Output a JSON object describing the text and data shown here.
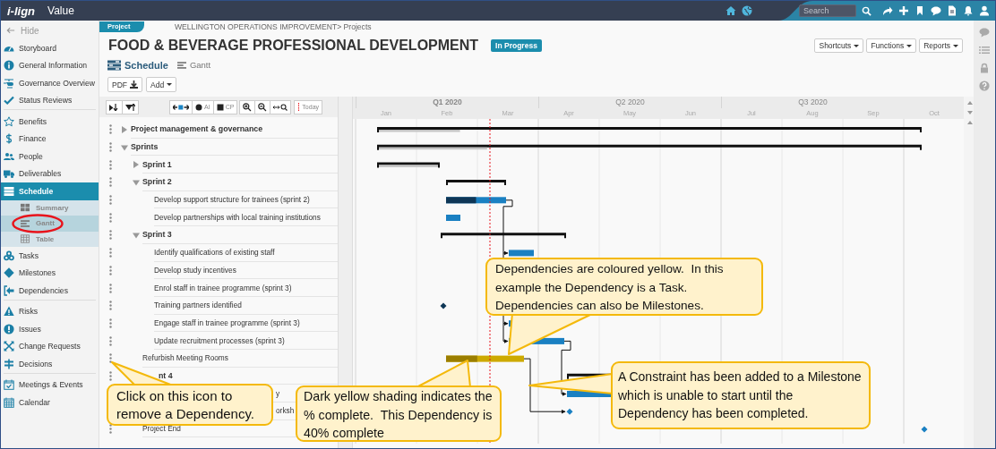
{
  "topbar": {
    "logo": "i-lign",
    "product": "Value",
    "search": {
      "placeholder": "Search"
    }
  },
  "sidebar": {
    "hide": "Hide",
    "groups": [
      {
        "items": [
          {
            "label": "Storyboard",
            "selected": false
          },
          {
            "label": "General Information",
            "selected": false
          },
          {
            "label": "Governance Overview",
            "selected": false
          },
          {
            "label": "Status Reviews",
            "selected": false
          }
        ]
      },
      {
        "items": [
          {
            "label": "Benefits",
            "selected": false
          },
          {
            "label": "Finance",
            "selected": false
          },
          {
            "label": "People",
            "selected": false
          },
          {
            "label": "Deliverables",
            "selected": false
          },
          {
            "label": "Schedule",
            "selected": true,
            "children": [
              {
                "label": "Summary",
                "selected": false,
                "circled": false
              },
              {
                "label": "Gantt",
                "selected": true,
                "circled": true
              },
              {
                "label": "Table",
                "selected": false,
                "circled": false
              }
            ]
          },
          {
            "label": "Tasks",
            "selected": false
          },
          {
            "label": "Milestones",
            "selected": false
          },
          {
            "label": "Dependencies",
            "selected": false
          }
        ]
      },
      {
        "items": [
          {
            "label": "Risks",
            "selected": false
          },
          {
            "label": "Issues",
            "selected": false
          },
          {
            "label": "Change Requests",
            "selected": false
          },
          {
            "label": "Decisions",
            "selected": false
          }
        ]
      },
      {
        "items": [
          {
            "label": "Meetings & Events",
            "selected": false
          },
          {
            "label": "Calendar",
            "selected": false
          }
        ]
      }
    ]
  },
  "header": {
    "tab": "Project",
    "breadcrumb": "WELLINGTON OPERATIONS IMPROVEMENT> Projects",
    "title": "FOOD & BEVERAGE PROFESSIONAL DEVELOPMENT",
    "status": "In Progress",
    "menus": [
      "Shortcuts",
      "Functions",
      "Reports"
    ],
    "view": "Schedule",
    "subview": "Gantt",
    "actions": [
      {
        "kind": "pdf",
        "label": "PDF"
      },
      {
        "kind": "menu",
        "label": "Add"
      }
    ]
  },
  "gantt": {
    "toolbar": [
      {
        "kind": "expand"
      },
      {
        "kind": "collapse"
      },
      {
        "kind": "scroll"
      },
      {
        "kind": "ai",
        "label": "AI"
      },
      {
        "kind": "cp",
        "label": "CP"
      },
      {
        "kind": "zoom-in"
      },
      {
        "kind": "zoom-out"
      },
      {
        "kind": "fit"
      },
      {
        "kind": "today",
        "label": "Today"
      }
    ],
    "quarters": [
      "Q1 2020",
      "Q2 2020",
      "Q3 2020"
    ],
    "months": [
      "Jan",
      "Feb",
      "Mar",
      "Apr",
      "May",
      "Jun",
      "Jul",
      "Aug",
      "Sep",
      "Oct"
    ],
    "rows": [
      {
        "label": "Project management & governance",
        "expanded": false,
        "kind": "summary",
        "level": 0.15
      },
      {
        "label": "Sprints",
        "expanded": true,
        "kind": "summary",
        "level": 0.2,
        "children": [
          {
            "label": "Sprint 1",
            "expanded": false,
            "kind": "summary",
            "level": 1
          },
          {
            "label": "Sprint 2",
            "expanded": true,
            "kind": "summary",
            "children": [
              {
                "label": "Develop support structure for trainees (sprint 2)",
                "kind": "task",
                "level": 0.5
              },
              {
                "label": "Develop partnerships with local training institutions",
                "kind": "task"
              }
            ]
          },
          {
            "label": "Sprint 3",
            "expanded": true,
            "kind": "summary",
            "children": [
              {
                "label": "Identify qualifications of existing staff",
                "kind": "task"
              },
              {
                "label": "Develop study incentives"
              },
              {
                "label": "Enrol staff in trainee programme (sprint 3)"
              },
              {
                "label": "Training partners identified",
                "kind": "milestone",
                "done": true
              },
              {
                "label": "Engage staff in trainee programme (sprint 3)",
                "kind": "task"
              },
              {
                "label": "Update recruitment processes (sprint 3)",
                "kind": "task"
              }
            ]
          },
          {
            "label": "Refurbish Meeting Rooms",
            "kind": "dependency",
            "level": 0.4
          },
          {
            "label": "nt 4",
            "clipped": true,
            "kind": "summary",
            "children": [
              {
                "label": "y",
                "clipped": true,
                "kind": "task"
              },
              {
                "label": "orksh",
                "clipped": true,
                "kind": "milestone"
              }
            ]
          },
          {
            "label": "Project End",
            "kind": "milestone"
          }
        ]
      }
    ]
  },
  "callouts": [
    {
      "text": "Dependencies are coloured yellow.  In this example the Dependency is a Task.  Dependencies can also be Milestones."
    },
    {
      "text": "Click on this icon to remove a Dependency."
    },
    {
      "text": "Dark yellow shading indicates the % complete.  This Dependency is 40% complete"
    },
    {
      "text": "A Constraint has been added to a Milestone which is unable to start until the Dependency has been completed."
    }
  ]
}
